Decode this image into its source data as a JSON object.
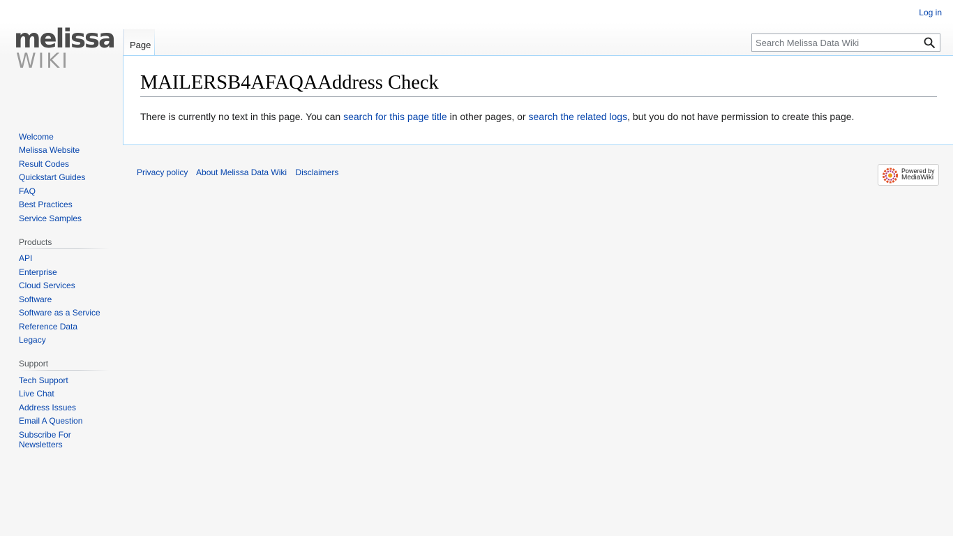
{
  "personal": {
    "login": "Log in"
  },
  "logo": {
    "top": "melissa",
    "bottom": "WIKI"
  },
  "tabs": [
    {
      "label": "Page"
    }
  ],
  "search": {
    "placeholder": "Search Melissa Data Wiki"
  },
  "page": {
    "title": "MAILERSB4AFAQAAddress Check",
    "text_before": "There is currently no text in this page. You can ",
    "link1": "search for this page title",
    "text_middle": " in other pages, or ",
    "link2": "search the related logs",
    "text_after": ", but you do not have permission to create this page."
  },
  "sidebar": {
    "navigation": [
      {
        "label": "Welcome"
      },
      {
        "label": "Melissa Website"
      },
      {
        "label": "Result Codes"
      },
      {
        "label": "Quickstart Guides"
      },
      {
        "label": "FAQ"
      },
      {
        "label": "Best Practices"
      },
      {
        "label": "Service Samples"
      }
    ],
    "products": {
      "heading": "Products",
      "items": [
        {
          "label": "API"
        },
        {
          "label": "Enterprise"
        },
        {
          "label": "Cloud Services"
        },
        {
          "label": "Software"
        },
        {
          "label": "Software as a Service"
        },
        {
          "label": "Reference Data"
        },
        {
          "label": "Legacy"
        }
      ]
    },
    "support": {
      "heading": "Support",
      "items": [
        {
          "label": "Tech Support"
        },
        {
          "label": "Live Chat"
        },
        {
          "label": "Address Issues"
        },
        {
          "label": "Email A Question"
        },
        {
          "label": "Subscribe For Newsletters"
        }
      ]
    }
  },
  "footer": {
    "links": [
      {
        "label": "Privacy policy"
      },
      {
        "label": "About Melissa Data Wiki"
      },
      {
        "label": "Disclaimers"
      }
    ],
    "powered_top": "Powered by",
    "powered_bottom": "MediaWiki"
  },
  "colors": {
    "link": "#0645ad",
    "border": "#a7d7f9",
    "background": "#f6f6f6"
  },
  "icons": {
    "search": "search-icon",
    "mediawiki": "mediawiki-logo-icon"
  }
}
